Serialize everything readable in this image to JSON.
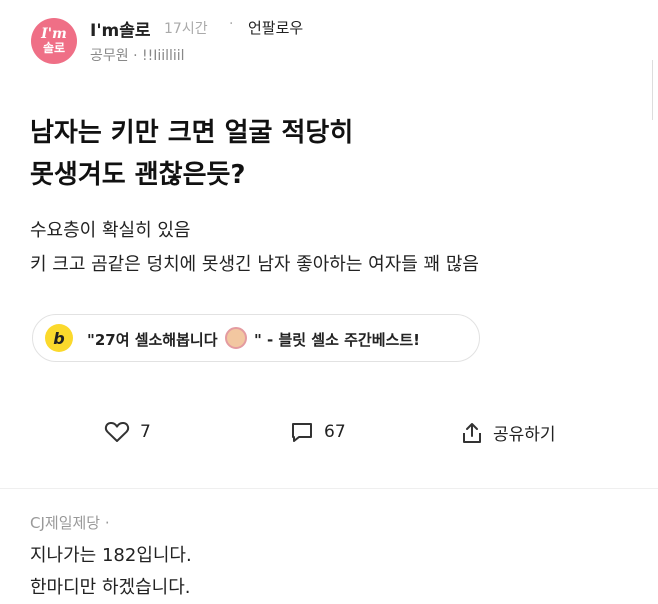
{
  "header": {
    "avatar_line1": "I'm",
    "avatar_line2": "솔로",
    "board_name": "I'm솔로",
    "time": "17시간",
    "separator": "·",
    "follow_label": "언팔로우",
    "author": "공무원 · !!Iiilliil"
  },
  "post": {
    "title_line1": "남자는 키만 크면 얼굴 적당히",
    "title_line2": "못생겨도 괜찮은듯?",
    "body_line1": "수요층이 확실히 있음",
    "body_line2": "키 크고 곰같은 덩치에 못생긴 남자 좋아하는 여자들 꽤 많음"
  },
  "promo": {
    "logo_letter": "b",
    "text_before": "\"27여 셀소해봅니다",
    "text_after": "\" - 블릿 셀소 주간베스트!"
  },
  "actions": {
    "likes": "7",
    "comments": "67",
    "share_label": "공유하기"
  },
  "comment": {
    "author": "CJ제일제당 ·",
    "line1": "지나가는 182입니다.",
    "line2": "한마디만 하겠습니다."
  }
}
